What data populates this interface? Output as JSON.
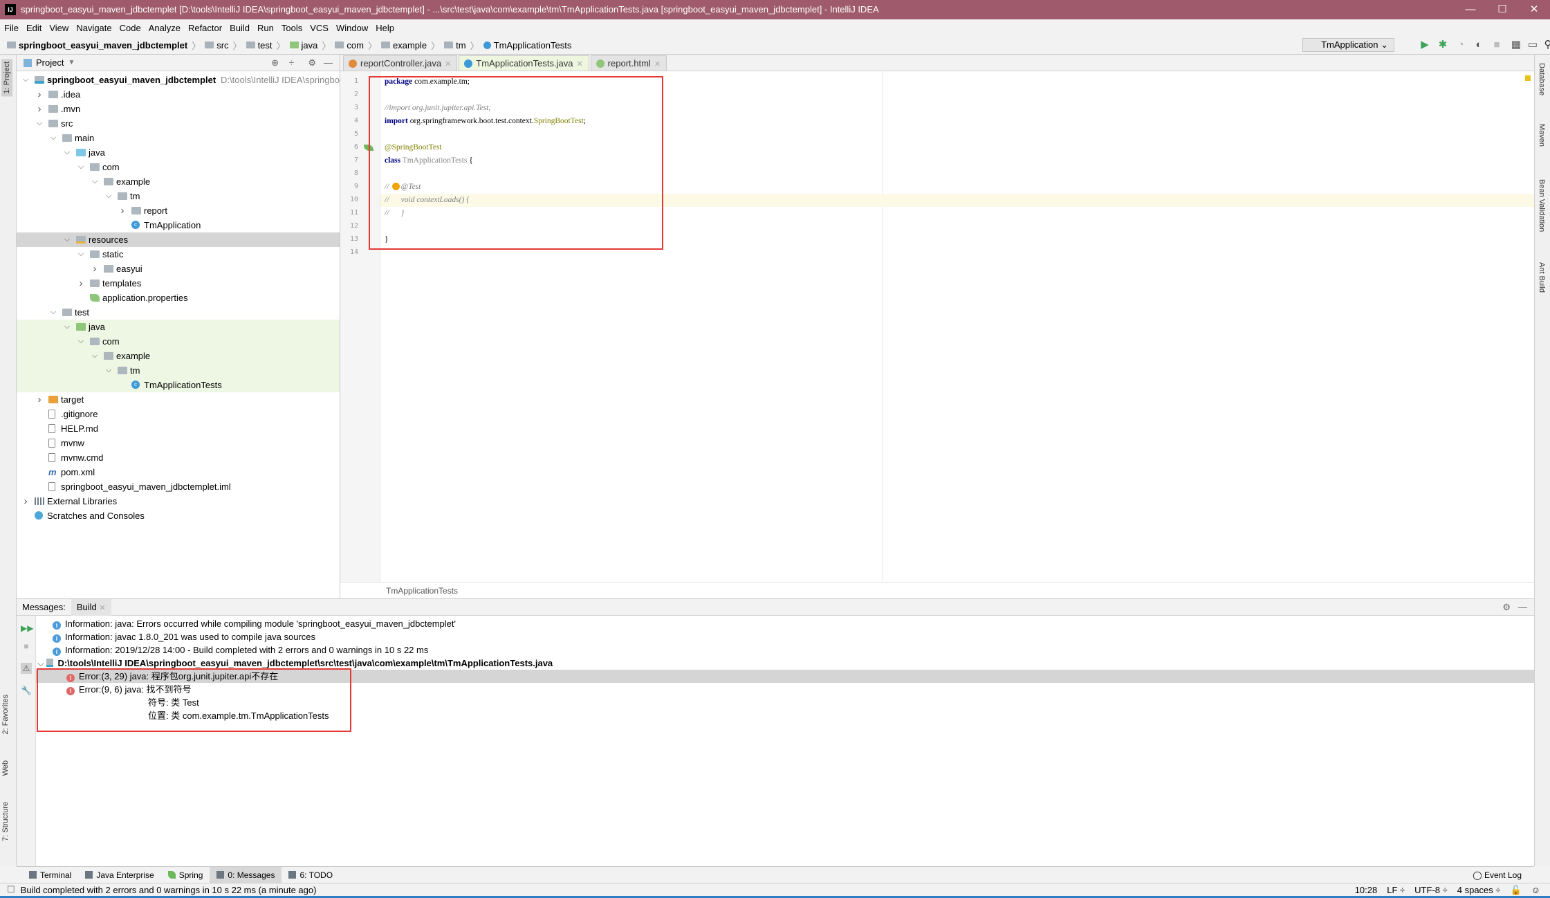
{
  "window": {
    "title": "springboot_easyui_maven_jdbctemplet [D:\\tools\\IntelliJ IDEA\\springboot_easyui_maven_jdbctemplet] - ...\\src\\test\\java\\com\\example\\tm\\TmApplicationTests.java [springboot_easyui_maven_jdbctemplet] - IntelliJ IDEA",
    "logo": "IJ",
    "title_color": "#9f5b6b"
  },
  "menu": [
    "File",
    "Edit",
    "View",
    "Navigate",
    "Code",
    "Analyze",
    "Refactor",
    "Build",
    "Run",
    "Tools",
    "VCS",
    "Window",
    "Help"
  ],
  "breadcrumb": [
    "springboot_easyui_maven_jdbctemplet",
    "src",
    "test",
    "java",
    "com",
    "example",
    "tm",
    "TmApplicationTests"
  ],
  "toolbar": {
    "run_config": "TmApplication"
  },
  "left_strip": {
    "project": "1: Project",
    "favorites": "2: Favorites",
    "web": "Web",
    "structure": "7: Structure"
  },
  "right_strip": [
    "Database",
    "Maven",
    "Bean Validation",
    "Ant Build"
  ],
  "project": {
    "header": "Project",
    "tree": [
      {
        "d": 0,
        "a": "open",
        "i": "mod",
        "l": "springboot_easyui_maven_jdbctemplet",
        "bold": true,
        "path": "D:\\tools\\IntelliJ IDEA\\springboo"
      },
      {
        "d": 1,
        "a": "closed",
        "i": "folder",
        "l": ".idea"
      },
      {
        "d": 1,
        "a": "closed",
        "i": "folder",
        "l": ".mvn"
      },
      {
        "d": 1,
        "a": "open",
        "i": "folder",
        "l": "src"
      },
      {
        "d": 2,
        "a": "open",
        "i": "folder",
        "l": "main"
      },
      {
        "d": 3,
        "a": "open",
        "i": "src",
        "l": "java"
      },
      {
        "d": 4,
        "a": "open",
        "i": "folder",
        "l": "com"
      },
      {
        "d": 5,
        "a": "open",
        "i": "folder",
        "l": "example"
      },
      {
        "d": 6,
        "a": "open",
        "i": "folder",
        "l": "tm"
      },
      {
        "d": 7,
        "a": "closed",
        "i": "folder",
        "l": "report"
      },
      {
        "d": 7,
        "a": "none",
        "i": "cls",
        "l": "TmApplication"
      },
      {
        "d": 3,
        "a": "open",
        "i": "res",
        "l": "resources",
        "selected": true
      },
      {
        "d": 4,
        "a": "open",
        "i": "folder",
        "l": "static"
      },
      {
        "d": 5,
        "a": "closed",
        "i": "folder",
        "l": "easyui"
      },
      {
        "d": 4,
        "a": "closed",
        "i": "folder",
        "l": "templates"
      },
      {
        "d": 4,
        "a": "none",
        "i": "props",
        "l": "application.properties"
      },
      {
        "d": 2,
        "a": "open",
        "i": "folder",
        "l": "test"
      },
      {
        "d": 3,
        "a": "open",
        "i": "test",
        "l": "java",
        "green": true
      },
      {
        "d": 4,
        "a": "open",
        "i": "folder",
        "l": "com",
        "green": true
      },
      {
        "d": 5,
        "a": "open",
        "i": "folder",
        "l": "example",
        "green": true
      },
      {
        "d": 6,
        "a": "open",
        "i": "folder",
        "l": "tm",
        "green": true
      },
      {
        "d": 7,
        "a": "none",
        "i": "cls",
        "l": "TmApplicationTests",
        "green": true
      },
      {
        "d": 1,
        "a": "closed",
        "i": "excl",
        "l": "target"
      },
      {
        "d": 1,
        "a": "none",
        "i": "file",
        "l": ".gitignore"
      },
      {
        "d": 1,
        "a": "none",
        "i": "file",
        "l": "HELP.md"
      },
      {
        "d": 1,
        "a": "none",
        "i": "file",
        "l": "mvnw"
      },
      {
        "d": 1,
        "a": "none",
        "i": "file",
        "l": "mvnw.cmd"
      },
      {
        "d": 1,
        "a": "none",
        "i": "pom",
        "l": "pom.xml"
      },
      {
        "d": 1,
        "a": "none",
        "i": "file",
        "l": "springboot_easyui_maven_jdbctemplet.iml"
      },
      {
        "d": 0,
        "a": "closed",
        "i": "lib",
        "l": "External Libraries"
      },
      {
        "d": 0,
        "a": "none",
        "i": "scr",
        "l": "Scratches and Consoles"
      }
    ]
  },
  "editor": {
    "tabs": [
      {
        "label": "reportController.java",
        "color": "#e08a3c",
        "active": false
      },
      {
        "label": "TmApplicationTests.java",
        "color": "#3d9ad6",
        "active": true
      },
      {
        "label": "report.html",
        "color": "#8fc67a",
        "active": false
      }
    ],
    "highlighted_line": 10,
    "lines": [
      [
        {
          "k": "kw",
          "t": "package"
        },
        {
          "k": "tx",
          "t": " com.example.tm;"
        }
      ],
      [],
      [
        {
          "k": "cm",
          "t": "//import org.junit.jupiter.api.Test;"
        }
      ],
      [
        {
          "k": "kw",
          "t": "import"
        },
        {
          "k": "tx",
          "t": " org.springframework.boot.test.context."
        },
        {
          "k": "ty",
          "t": "SpringBootTest"
        },
        {
          "k": "tx",
          "t": ";"
        }
      ],
      [],
      [
        {
          "k": "an",
          "t": "@SpringBootTest"
        }
      ],
      [
        {
          "k": "kw",
          "t": "class"
        },
        {
          "k": "dim",
          "t": " TmApplicationTests "
        },
        {
          "k": "tx",
          "t": "{"
        }
      ],
      [],
      [
        {
          "k": "cm",
          "t": "//      @Test"
        }
      ],
      [
        {
          "k": "cm",
          "t": "//      void contextLoads() {"
        }
      ],
      [
        {
          "k": "cm",
          "t": "//      }"
        }
      ],
      [],
      [
        {
          "k": "tx",
          "t": "}"
        }
      ],
      []
    ],
    "footer_crumb": "TmApplicationTests"
  },
  "messages": {
    "label": "Messages:",
    "tab": "Build",
    "rows": [
      {
        "type": "info",
        "text": "Information: java: Errors occurred while compiling module 'springboot_easyui_maven_jdbctemplet'"
      },
      {
        "type": "info",
        "text": "Information: javac 1.8.0_201 was used to compile java sources"
      },
      {
        "type": "info",
        "text": "Information: 2019/12/28 14:00 - Build completed with 2 errors and 0 warnings in 10 s 22 ms"
      },
      {
        "type": "file",
        "text": "D:\\tools\\IntelliJ IDEA\\springboot_easyui_maven_jdbctemplet\\src\\test\\java\\com\\example\\tm\\TmApplicationTests.java"
      },
      {
        "type": "error",
        "text": "Error:(3, 29)  java: 程序包org.junit.jupiter.api不存在",
        "selected": true
      },
      {
        "type": "error",
        "text": "Error:(9, 6)  java: 找不到符号"
      },
      {
        "type": "detail",
        "text": "符号:   类 Test"
      },
      {
        "type": "detail",
        "text": "位置: 类 com.example.tm.TmApplicationTests"
      }
    ]
  },
  "tool_tabs": [
    {
      "label": "Terminal"
    },
    {
      "label": "Java Enterprise"
    },
    {
      "label": "Spring"
    },
    {
      "label": "0: Messages",
      "active": true
    },
    {
      "label": "6: TODO"
    }
  ],
  "event_log": "Event Log",
  "status": {
    "message": "Build completed with 2 errors and 0 warnings in 10 s 22 ms (a minute ago)",
    "position": "10:28",
    "line_sep": "LF ÷",
    "encoding": "UTF-8 ÷",
    "indent": "4 spaces ÷"
  }
}
